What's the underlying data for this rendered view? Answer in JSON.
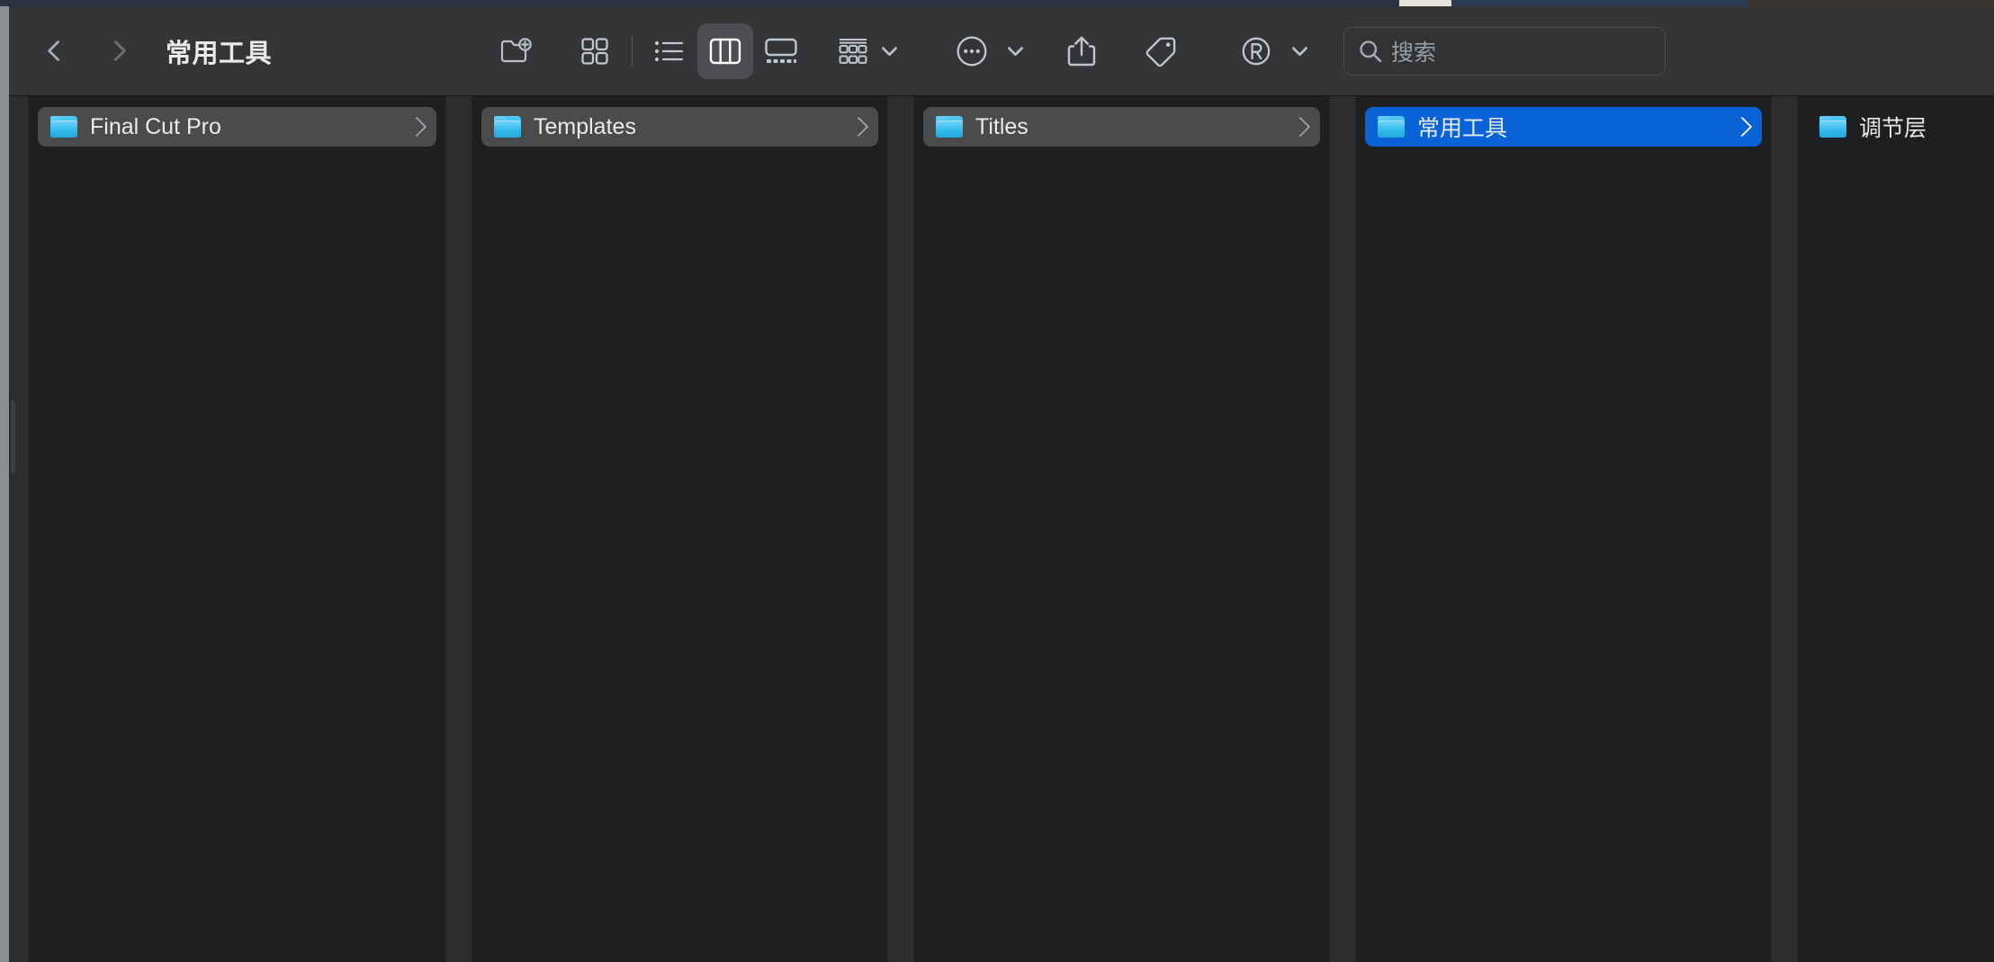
{
  "window": {
    "title": "常用工具",
    "accent_color": "#0a63d6",
    "toolbar_bg": "#333537",
    "content_bg": "#1e1f21"
  },
  "nav": {
    "back_label": "后退",
    "back_icon": "chevron-left-icon",
    "forward_label": "前进",
    "forward_icon": "chevron-right-icon"
  },
  "toolbar": {
    "new_folder": {
      "label": "新建文件夹",
      "icon": "new-folder-icon"
    },
    "view_icon": {
      "label": "图标显示方式",
      "icon": "grid-view-icon",
      "selected": false
    },
    "view_list": {
      "label": "列表显示方式",
      "icon": "list-view-icon",
      "selected": false
    },
    "view_column": {
      "label": "分栏显示方式",
      "icon": "column-view-icon",
      "selected": true
    },
    "view_gallery": {
      "label": "画廊显示方式",
      "icon": "gallery-view-icon",
      "selected": false
    },
    "group_by": {
      "label": "分组方式",
      "icon": "group-by-icon"
    },
    "group_by_caret": {
      "label": "分组方式菜单",
      "icon": "chevron-down-icon"
    },
    "more": {
      "label": "更多",
      "icon": "ellipsis-circle-icon"
    },
    "more_caret": {
      "label": "更多菜单",
      "icon": "chevron-down-icon"
    },
    "share": {
      "label": "共享",
      "icon": "share-icon"
    },
    "tag": {
      "label": "标记",
      "icon": "tag-icon"
    },
    "extension": {
      "label": "扩展",
      "icon": "registered-r-icon"
    },
    "extension_caret": {
      "label": "扩展菜单",
      "icon": "chevron-down-icon"
    }
  },
  "search": {
    "placeholder": "搜索",
    "value": "",
    "icon": "search-icon"
  },
  "columns": [
    {
      "id": "col-1",
      "items": [
        {
          "name": "Final Cut Pro",
          "icon": "folder-icon",
          "selection": "inactive",
          "has_children": true
        }
      ]
    },
    {
      "id": "col-2",
      "items": [
        {
          "name": "Templates",
          "icon": "folder-icon",
          "selection": "inactive",
          "has_children": true
        }
      ]
    },
    {
      "id": "col-3",
      "items": [
        {
          "name": "Titles",
          "icon": "folder-icon",
          "selection": "inactive",
          "has_children": true
        }
      ]
    },
    {
      "id": "col-4",
      "items": [
        {
          "name": "常用工具",
          "icon": "folder-icon",
          "selection": "active",
          "has_children": true
        }
      ]
    },
    {
      "id": "col-5",
      "items": [
        {
          "name": "调节层",
          "icon": "folder-icon",
          "selection": "none",
          "has_children": false
        }
      ]
    }
  ]
}
